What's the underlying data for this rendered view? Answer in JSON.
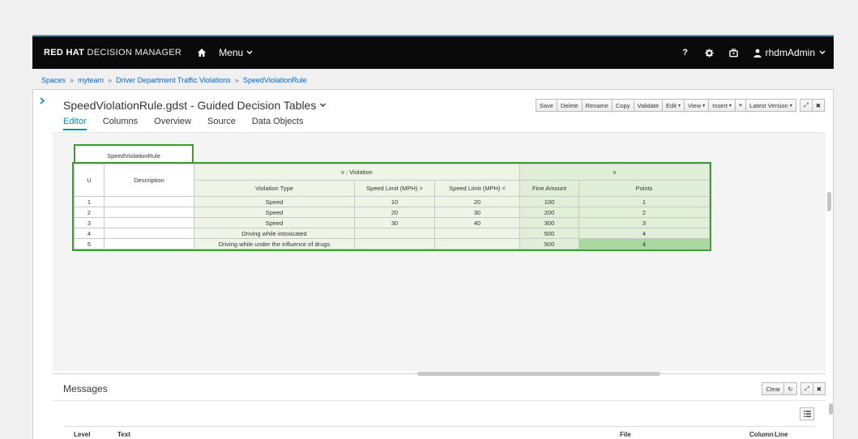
{
  "navbar": {
    "brand_bold": "RED HAT",
    "brand_light": "DECISION MANAGER",
    "menu_label": "Menu",
    "help_label": "?",
    "user": "rhdmAdmin"
  },
  "breadcrumb": [
    "Spaces",
    "myteam",
    "Driver Department Traffic Violations",
    "SpeedViolationRule"
  ],
  "breadcrumb_sep": "»",
  "document": {
    "title": "SpeedViolationRule.gdst - Guided Decision Tables",
    "toolbar": {
      "save": "Save",
      "delete": "Delete",
      "rename": "Rename",
      "copy": "Copy",
      "validate": "Validate",
      "edit": "Edit",
      "view": "View",
      "insert": "Insert",
      "latest_version": "Latest Version"
    }
  },
  "tabs": [
    "Editor",
    "Columns",
    "Overview",
    "Source",
    "Data Objects"
  ],
  "table": {
    "name": "SpeedViolationRule",
    "col_u": "U",
    "col_description": "Description",
    "condition_group": "v : Violation",
    "action_group": "v",
    "columns": [
      "Violation Type",
      "Speed Limit (MPH) >",
      "Speed Limit (MPH) <",
      "Fine Amount",
      "Points"
    ],
    "rows": [
      {
        "num": "1",
        "desc": "",
        "type": "Speed",
        "gt": "10",
        "lt": "20",
        "fine": "100",
        "points": "1"
      },
      {
        "num": "2",
        "desc": "",
        "type": "Speed",
        "gt": "20",
        "lt": "30",
        "fine": "200",
        "points": "2"
      },
      {
        "num": "3",
        "desc": "",
        "type": "Speed",
        "gt": "30",
        "lt": "40",
        "fine": "300",
        "points": "3"
      },
      {
        "num": "4",
        "desc": "",
        "type": "Driving while intoxicated",
        "gt": "",
        "lt": "",
        "fine": "500",
        "points": "4"
      },
      {
        "num": "5",
        "desc": "",
        "type": "Driving while under the influence of drugs",
        "gt": "",
        "lt": "",
        "fine": "500",
        "points": "4"
      }
    ]
  },
  "messages": {
    "title": "Messages",
    "clear": "Clear",
    "columns": {
      "level": "Level",
      "text": "Text",
      "file": "File",
      "column": "Column",
      "line": "Line"
    }
  }
}
